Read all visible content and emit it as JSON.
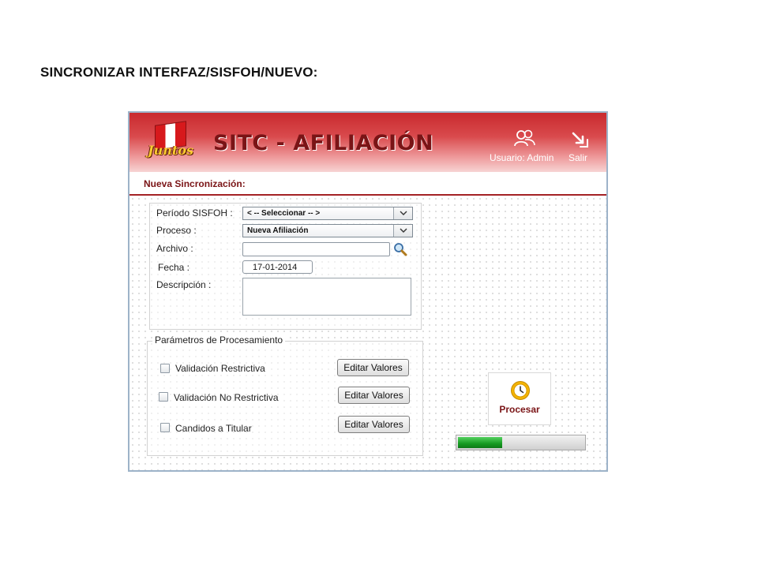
{
  "page": {
    "title": "SINCRONIZAR INTERFAZ/SISFOH/NUEVO:"
  },
  "app": {
    "logo_text": "Juntos",
    "title": "SITC - AFILIACIÓN",
    "user_label": "Usuario: Admin",
    "logout_label": "Salir",
    "icons": {
      "user": "users-icon",
      "logout": "exit-icon"
    },
    "colors": {
      "brand_red": "#c92a2e",
      "section_text": "#7a1416",
      "progress_green": "#169a21"
    }
  },
  "form": {
    "section_title": "Nueva Sincronización:",
    "periodo": {
      "label": "Período SISFOH :",
      "value": "< -- Seleccionar -- >"
    },
    "proceso": {
      "label": "Proceso :",
      "value": "Nueva Afiliación"
    },
    "archivo": {
      "label": "Archivo :",
      "value": ""
    },
    "fecha": {
      "label": "Fecha :",
      "value": "17-01-2014"
    },
    "descripcion": {
      "label": "Descripción :",
      "value": ""
    }
  },
  "params": {
    "legend": "Parámetros de Procesamiento",
    "items": [
      {
        "label": "Validación Restrictiva",
        "checked": false,
        "button": "Editar Valores"
      },
      {
        "label": "Validación No Restrictiva",
        "checked": false,
        "button": "Editar Valores"
      },
      {
        "label": "Candidos a Titular",
        "checked": false,
        "button": "Editar Valores"
      }
    ]
  },
  "actions": {
    "process_label": "Procesar",
    "process_icon": "clock-icon"
  },
  "progress": {
    "fraction": 0.35
  }
}
